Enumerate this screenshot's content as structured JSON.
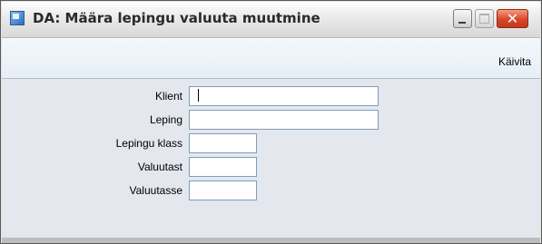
{
  "window": {
    "title": "DA: Määra lepingu valuuta muutmine",
    "icon": "app-document-icon",
    "controls": {
      "minimize": "minimize-icon",
      "maximize": "maximize-icon",
      "close_glyph": "✕"
    }
  },
  "toolbar": {
    "run_label": "Käivita"
  },
  "form": {
    "fields": [
      {
        "label": "Klient",
        "value": ""
      },
      {
        "label": "Leping",
        "value": ""
      },
      {
        "label": "Lepingu klass",
        "value": ""
      },
      {
        "label": "Valuutast",
        "value": ""
      },
      {
        "label": "Valuutasse",
        "value": ""
      }
    ]
  }
}
